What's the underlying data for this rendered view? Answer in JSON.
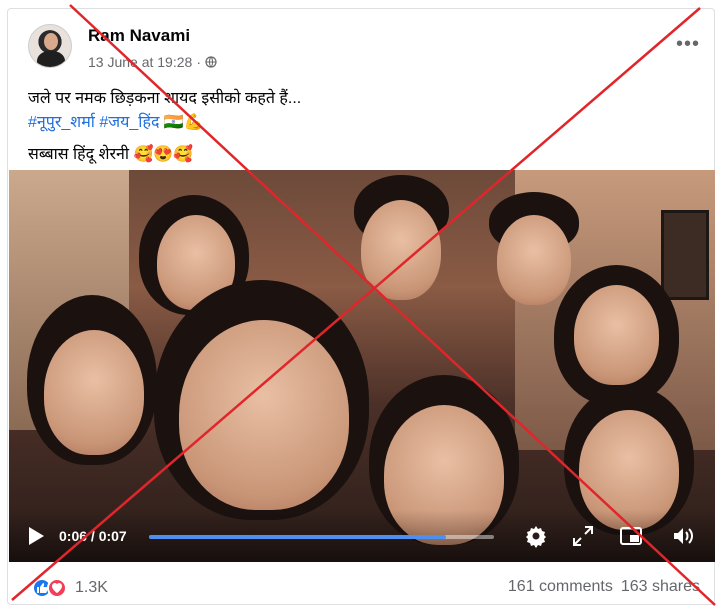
{
  "post": {
    "page_name": "Ram Navami",
    "date": "13 June at 19:28",
    "caption_line1": "जले पर नमक छिड़कना शायद इसीको कहते हैं...",
    "hashtags": [
      "#नूपुर_शर्मा",
      "#जय_हिंद"
    ],
    "hashtag_emoji": "🇮🇳💪",
    "caption_line3": "सब्बास हिंदू शेरनी",
    "caption_line3_emoji": "🥰😍🥰"
  },
  "video": {
    "time_display": "0:06 / 0:07",
    "progress": 0.86,
    "icons": [
      "play-icon",
      "settings-icon",
      "fullscreen-icon",
      "pip-icon",
      "volume-icon"
    ]
  },
  "footer": {
    "reaction_count": "1.3K",
    "comments": "161 comments",
    "shares": "163 shares"
  },
  "colors": {
    "hashtag": "#216fdb",
    "progress": "#4d8ff0",
    "cross": "#e0262b"
  }
}
